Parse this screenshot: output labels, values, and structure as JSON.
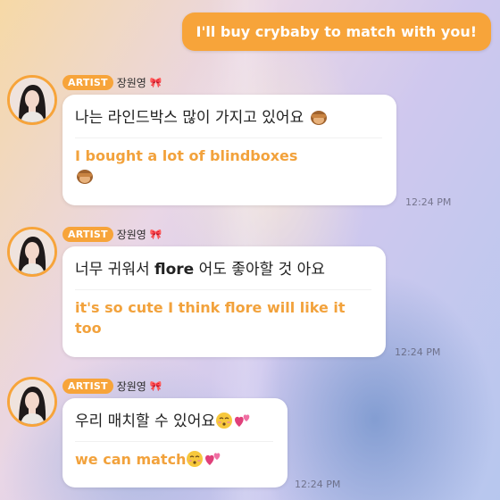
{
  "sent_message": {
    "text": "I'll buy crybaby to match with you!"
  },
  "messages": [
    {
      "badge": "ARTIST",
      "name": "장원영",
      "name_emoji": "bow-icon",
      "korean": "나는 라인드박스 많이 가지고 있어요",
      "english": "I bought a lot of blindboxes",
      "time": "12:24 PM"
    },
    {
      "badge": "ARTIST",
      "name": "장원영",
      "name_emoji": "bow-icon",
      "korean_pre": "너무 귀워서 ",
      "korean_bold": "flore",
      "korean_post": " 어도 좋아할 것 아요",
      "english": "it's so cute I think flore will like it too",
      "time": "12:24 PM"
    },
    {
      "badge": "ARTIST",
      "name": "장원영",
      "name_emoji": "bow-icon",
      "korean": "우리 매치할 수 있어요",
      "english": "we can match",
      "time": "12:24 PM"
    }
  ],
  "colors": {
    "accent": "#f7a43a",
    "english_text": "#f2a23c",
    "bubble": "#ffffff"
  }
}
